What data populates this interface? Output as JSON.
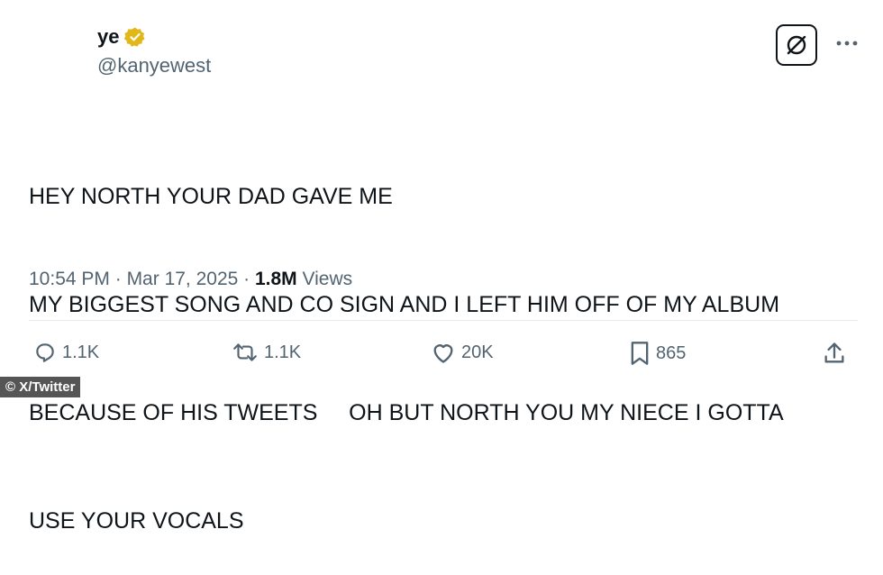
{
  "author": {
    "name": "ye",
    "handle": "@kanyewest",
    "verified_icon": "verified-badge-icon",
    "verified_color": "#e2b719"
  },
  "tweet": {
    "lines": [
      "HEY NORTH YOUR DAD GAVE ME",
      "MY BIGGEST SONG AND CO SIGN AND I LEFT HIM OFF OF MY ALBUM",
      "BECAUSE OF HIS TWEETS     OH BUT NORTH YOU MY NIECE I GOTTA",
      "USE YOUR VOCALS"
    ]
  },
  "meta": {
    "time": "10:54 PM",
    "separator": " · ",
    "date": "Mar 17, 2025",
    "views_count": "1.8M",
    "views_label": " Views"
  },
  "actions": {
    "reply_count": "1.1K",
    "repost_count": "1.1K",
    "like_count": "20K",
    "bookmark_count": "865"
  },
  "credit": "© X/Twitter"
}
